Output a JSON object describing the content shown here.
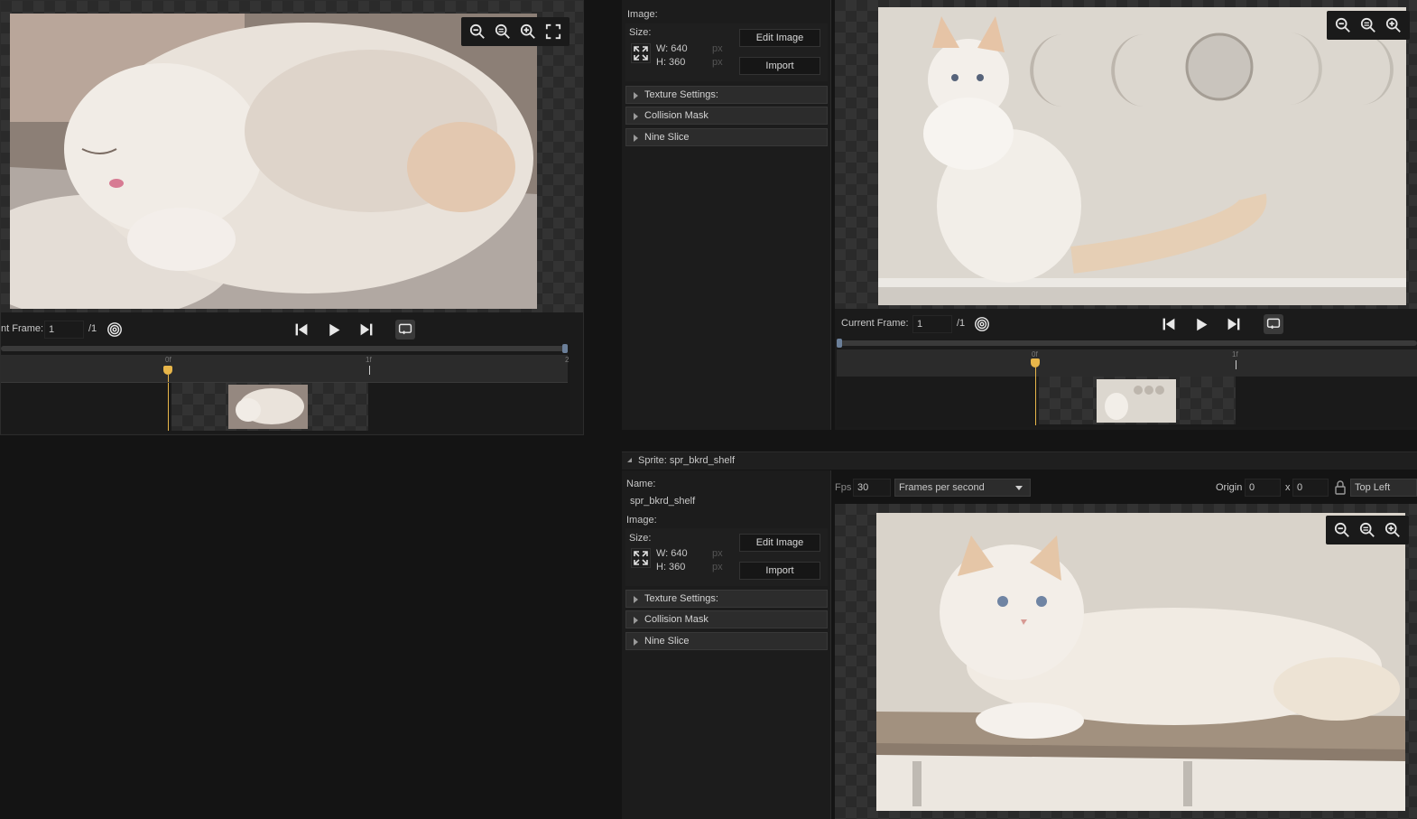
{
  "left_panel": {
    "current_frame_label": "nt Frame:",
    "current_frame_value": "1",
    "frame_total": "/1",
    "timeline_ticks": [
      "0f",
      "1f",
      "2"
    ]
  },
  "mid_panel_top": {
    "image_label": "Image:",
    "size_label": "Size:",
    "width": "W: 640",
    "height": "H: 360",
    "unit": "px",
    "edit_image": "Edit Image",
    "import": "Import",
    "sections": [
      "Texture Settings:",
      "Collision Mask",
      "Nine Slice"
    ]
  },
  "right_top": {
    "current_frame_label": "Current Frame:",
    "current_frame_value": "1",
    "frame_total": "/1",
    "timeline_ticks": [
      "0f",
      "1f"
    ]
  },
  "sprite_panel": {
    "title": "Sprite: spr_bkrd_shelf",
    "name_label": "Name:",
    "name_value": "spr_bkrd_shelf",
    "image_label": "Image:",
    "size_label": "Size:",
    "width": "W: 640",
    "height": "H: 360",
    "unit": "px",
    "edit_image": "Edit Image",
    "import": "Import",
    "sections": [
      "Texture Settings:",
      "Collision Mask",
      "Nine Slice"
    ],
    "fps_label": "Fps",
    "fps_value": "30",
    "fps_mode": "Frames per second",
    "origin_label": "Origin",
    "origin_x": "0",
    "origin_sep": "x",
    "origin_y": "0",
    "origin_preset": "Top Left"
  },
  "icons": [
    "zoom-out-icon",
    "zoom-reset-icon",
    "zoom-in-icon",
    "fullscreen-icon",
    "onion-skin-icon",
    "skip-start-icon",
    "play-icon",
    "skip-end-icon",
    "loop-icon",
    "lock-icon",
    "dropdown-chevron-icon",
    "expand-size-icon"
  ],
  "colors": {
    "playhead": "#e8b64a",
    "background": "#141414",
    "panel": "#1e1e1e"
  }
}
